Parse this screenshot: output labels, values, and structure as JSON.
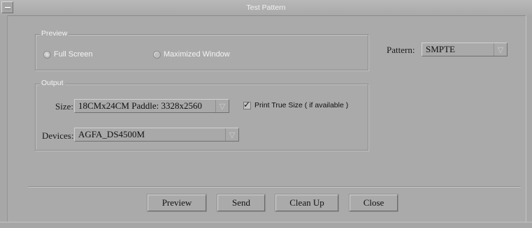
{
  "window": {
    "title": "Test Pattern"
  },
  "preview": {
    "legend": "Preview",
    "options": [
      {
        "label": "Full Screen",
        "selected": true
      },
      {
        "label": "Maximized Window",
        "selected": false
      }
    ]
  },
  "pattern": {
    "label": "Pattern:",
    "value": "SMPTE"
  },
  "output": {
    "legend": "Output",
    "size_label": "Size:",
    "size_value": "18CMx24CM Paddle: 3328x2560",
    "print_true_size_label": "Print True Size ( if available )",
    "print_true_size_checked": true,
    "devices_label": "Devices:",
    "devices_value": "AGFA_DS4500M"
  },
  "buttons": {
    "preview": "Preview",
    "send": "Send",
    "clean_up": "Clean Up",
    "close": "Close"
  },
  "icons": {
    "dropdown": "chevron-down-icon",
    "check": "checkmark-icon",
    "window_menu": "window-menu-icon"
  }
}
